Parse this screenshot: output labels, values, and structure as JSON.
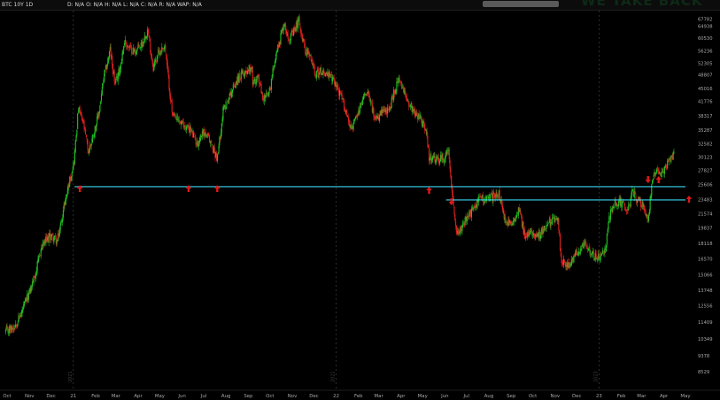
{
  "header": {
    "symbol_label": "BTC 10Y 1D",
    "studies_label": "D: N/A O: N/A H: N/A L: N/A C: N/A R: N/A WAP: N/A"
  },
  "watermark": {
    "text": "WE TAKE BACK"
  },
  "colors": {
    "background": "#000000",
    "up_candle": "#22c322",
    "down_candle": "#e02020",
    "support_line": "#3ad6f0",
    "arrow": "#e01818",
    "axis_text": "#a8a8a8",
    "separator": "#4a4a4a"
  },
  "chart_data": {
    "type": "candlestick",
    "title": "",
    "xlabel": "",
    "ylabel": "",
    "x_tick_labels": [
      "Oct",
      "Nov",
      "Dec",
      "21",
      "Feb",
      "Mar",
      "Apr",
      "May",
      "Jun",
      "Jul",
      "Aug",
      "Sep",
      "Oct",
      "Nov",
      "Dec",
      "22",
      "Feb",
      "Mar",
      "Apr",
      "May",
      "Jun",
      "Jul",
      "Aug",
      "Sep",
      "Oct",
      "Nov",
      "Dec",
      "23",
      "Feb",
      "Mar",
      "Apr",
      "May"
    ],
    "y_tick_labels": [
      "67782",
      "64938",
      "60530",
      "56236",
      "52305",
      "48807",
      "45016",
      "41776",
      "38317",
      "35287",
      "32582",
      "30123",
      "27827",
      "25606",
      "23483",
      "21574",
      "19837",
      "18118",
      "16570",
      "15066",
      "13748",
      "12556",
      "11409",
      "10349",
      "9378",
      "8529"
    ],
    "y_range": [
      8529,
      69000
    ],
    "y_scale": "log",
    "year_separators": [
      "2021",
      "2022",
      "2023"
    ],
    "horizontal_lines": [
      {
        "name": "support-1",
        "y": 25300,
        "from": "Jan 2021",
        "to": "Apr 2023"
      },
      {
        "name": "support-2",
        "y": 23400,
        "from": "Jun 2022",
        "to": "Apr 2023"
      }
    ],
    "arrows": [
      {
        "x": "Jan 2021",
        "direction": "up"
      },
      {
        "x": "Jun 2021",
        "direction": "up"
      },
      {
        "x": "Jul 2021",
        "direction": "up"
      },
      {
        "x": "May 2022",
        "direction": "up"
      },
      {
        "x": "Jun 2022",
        "direction": "down"
      },
      {
        "x": "Mar 2023",
        "direction": "down"
      },
      {
        "x": "Mar 2023",
        "direction": "up"
      },
      {
        "x": "Apr 2023",
        "direction": "up"
      }
    ],
    "series": [
      {
        "values": [
          [
            "2020-09-29",
            10800
          ],
          [
            "2020-10-10",
            11100
          ],
          [
            "2020-10-20",
            11900
          ],
          [
            "2020-11-01",
            13600
          ],
          [
            "2020-11-10",
            15300
          ],
          [
            "2020-11-18",
            17800
          ],
          [
            "2020-12-01",
            19000
          ],
          [
            "2020-12-10",
            18300
          ],
          [
            "2020-12-20",
            23000
          ],
          [
            "2020-12-28",
            26800
          ],
          [
            "2021-01-02",
            29500
          ],
          [
            "2021-01-08",
            40000
          ],
          [
            "2021-01-15",
            36500
          ],
          [
            "2021-01-22",
            31000
          ],
          [
            "2021-01-28",
            34000
          ],
          [
            "2021-02-05",
            38500
          ],
          [
            "2021-02-12",
            47500
          ],
          [
            "2021-02-21",
            56500
          ],
          [
            "2021-02-28",
            46000
          ],
          [
            "2021-03-07",
            51000
          ],
          [
            "2021-03-13",
            59500
          ],
          [
            "2021-03-20",
            57000
          ],
          [
            "2021-03-28",
            56000
          ],
          [
            "2021-04-06",
            58500
          ],
          [
            "2021-04-14",
            63500
          ],
          [
            "2021-04-22",
            51000
          ],
          [
            "2021-04-28",
            55000
          ],
          [
            "2021-05-08",
            58000
          ],
          [
            "2021-05-12",
            49500
          ],
          [
            "2021-05-19",
            38000
          ],
          [
            "2021-05-25",
            37500
          ],
          [
            "2021-06-05",
            36000
          ],
          [
            "2021-06-12",
            35500
          ],
          [
            "2021-06-22",
            32500
          ],
          [
            "2021-06-30",
            35000
          ],
          [
            "2021-07-08",
            33500
          ],
          [
            "2021-07-20",
            29900
          ],
          [
            "2021-07-28",
            39500
          ],
          [
            "2021-08-08",
            44000
          ],
          [
            "2021-08-15",
            47000
          ],
          [
            "2021-08-24",
            49000
          ],
          [
            "2021-09-06",
            51500
          ],
          [
            "2021-09-07",
            46500
          ],
          [
            "2021-09-15",
            48000
          ],
          [
            "2021-09-21",
            42500
          ],
          [
            "2021-09-30",
            43500
          ],
          [
            "2021-10-08",
            54000
          ],
          [
            "2021-10-15",
            60000
          ],
          [
            "2021-10-20",
            66000
          ],
          [
            "2021-10-28",
            60500
          ],
          [
            "2021-11-03",
            62500
          ],
          [
            "2021-11-10",
            67500
          ],
          [
            "2021-11-18",
            57000
          ],
          [
            "2021-11-26",
            54000
          ],
          [
            "2021-12-04",
            49000
          ],
          [
            "2021-12-12",
            50000
          ],
          [
            "2021-12-22",
            48500
          ],
          [
            "2021-12-31",
            46500
          ],
          [
            "2022-01-10",
            41800
          ],
          [
            "2022-01-22",
            35500
          ],
          [
            "2022-01-31",
            38500
          ],
          [
            "2022-02-10",
            44000
          ],
          [
            "2022-02-15",
            44500
          ],
          [
            "2022-02-24",
            37000
          ],
          [
            "2022-03-05",
            39000
          ],
          [
            "2022-03-15",
            39500
          ],
          [
            "2022-03-28",
            47500
          ],
          [
            "2022-04-06",
            43500
          ],
          [
            "2022-04-15",
            40500
          ],
          [
            "2022-04-26",
            38000
          ],
          [
            "2022-05-05",
            36000
          ],
          [
            "2022-05-10",
            30000
          ],
          [
            "2022-05-20",
            29500
          ],
          [
            "2022-06-01",
            30000
          ],
          [
            "2022-06-06",
            31500
          ],
          [
            "2022-06-13",
            22500
          ],
          [
            "2022-06-18",
            19000
          ],
          [
            "2022-06-28",
            20500
          ],
          [
            "2022-07-08",
            21800
          ],
          [
            "2022-07-20",
            23800
          ],
          [
            "2022-07-28",
            23500
          ],
          [
            "2022-08-10",
            24000
          ],
          [
            "2022-08-15",
            24400
          ],
          [
            "2022-08-22",
            21000
          ],
          [
            "2022-09-01",
            20000
          ],
          [
            "2022-09-12",
            22500
          ],
          [
            "2022-09-20",
            18700
          ],
          [
            "2022-09-30",
            19500
          ],
          [
            "2022-10-10",
            19000
          ],
          [
            "2022-10-25",
            20500
          ],
          [
            "2022-11-05",
            21300
          ],
          [
            "2022-11-09",
            16500
          ],
          [
            "2022-11-21",
            15800
          ],
          [
            "2022-12-01",
            17200
          ],
          [
            "2022-12-14",
            18000
          ],
          [
            "2022-12-25",
            16800
          ],
          [
            "2023-01-01",
            16600
          ],
          [
            "2023-01-10",
            17400
          ],
          [
            "2023-01-14",
            20800
          ],
          [
            "2023-01-21",
            22700
          ],
          [
            "2023-01-31",
            23100
          ],
          [
            "2023-02-10",
            21800
          ],
          [
            "2023-02-16",
            24500
          ],
          [
            "2023-02-25",
            23200
          ],
          [
            "2023-03-05",
            22400
          ],
          [
            "2023-03-10",
            20200
          ],
          [
            "2023-03-14",
            24500
          ],
          [
            "2023-03-19",
            27900
          ],
          [
            "2023-03-28",
            27000
          ],
          [
            "2023-04-03",
            28000
          ],
          [
            "2023-04-11",
            30200
          ],
          [
            "2023-04-15",
            30400
          ]
        ]
      }
    ]
  }
}
